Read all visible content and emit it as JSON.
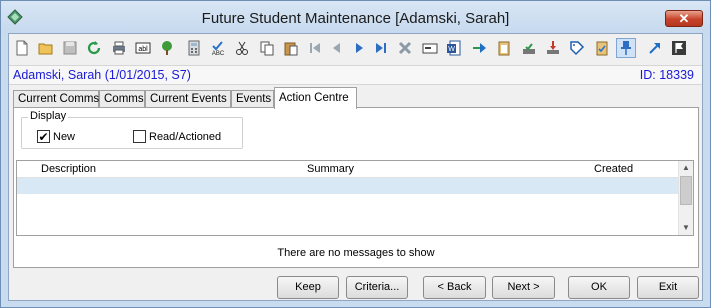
{
  "window": {
    "title": "Future Student Maintenance  [Adamski, Sarah]",
    "close_label": "✕"
  },
  "toolbar": {
    "icons": [
      "new-icon",
      "open-folder-icon",
      "save-icon",
      "refresh-icon",
      "print-icon",
      "abl-text-icon",
      "tree-icon",
      "calculator-icon",
      "spellcheck-icon",
      "cut-icon",
      "copy-icon",
      "paste-icon",
      "first-record-icon",
      "previous-record-icon",
      "next-record-icon",
      "last-record-icon",
      "delete-icon",
      "card-icon",
      "word-doc-icon",
      "send-arrow-icon",
      "clipboard-icon",
      "mail-tray-icon",
      "download-tray-icon",
      "tag-icon",
      "checklist-icon",
      "pin-icon",
      "link-arrow-icon",
      "flag-icon"
    ],
    "active_icon": "pin-icon"
  },
  "record": {
    "name": "Adamski, Sarah (1/01/2015, S7)",
    "id_text": "ID: 18339"
  },
  "tabs": [
    {
      "label": "Current Comms",
      "active": false
    },
    {
      "label": "Comms",
      "active": false
    },
    {
      "label": "Current Events",
      "active": false
    },
    {
      "label": "Events",
      "active": false
    },
    {
      "label": "Action Centre",
      "active": true
    }
  ],
  "display": {
    "label": "Display",
    "new_label": "New",
    "new_checked": true,
    "read_label": "Read/Actioned",
    "read_checked": false
  },
  "grid": {
    "columns": [
      "Description",
      "Summary",
      "Created"
    ],
    "empty_message": "There are no messages to show"
  },
  "buttons": {
    "keep": "Keep",
    "criteria": "Criteria...",
    "back": "< Back",
    "next": "Next >",
    "ok": "OK",
    "exit": "Exit"
  },
  "colors": {
    "info_text": "#1a1ad6",
    "selected_row": "#d9e8f5",
    "close_button": "#c7432b"
  }
}
